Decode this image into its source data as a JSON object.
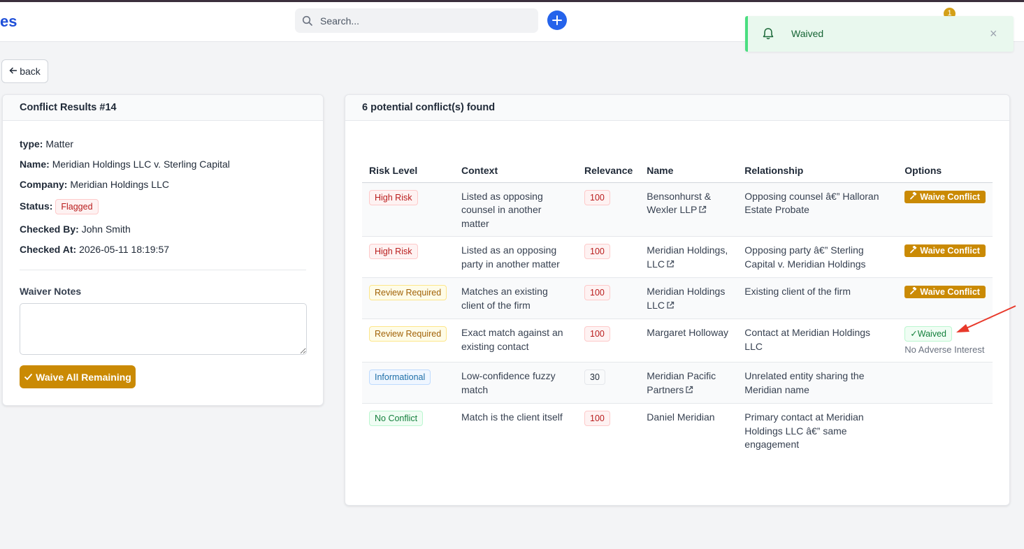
{
  "header": {
    "brand": "es",
    "search_placeholder": "Search...",
    "notification_count": "1"
  },
  "toast": {
    "message": "Waived",
    "close": "×"
  },
  "back_label": "back",
  "details": {
    "title": "Conflict Results #14",
    "type_label": "type:",
    "type_value": "Matter",
    "name_label": "Name:",
    "name_value": "Meridian Holdings LLC v. Sterling Capital",
    "company_label": "Company:",
    "company_value": "Meridian Holdings LLC",
    "status_label": "Status:",
    "status_value": "Flagged",
    "checked_by_label": "Checked By:",
    "checked_by_value": "John Smith",
    "checked_at_label": "Checked At:",
    "checked_at_value": "2026-05-11 18:19:57",
    "waiver_notes_label": "Waiver Notes",
    "waive_all_label": "Waive All Remaining"
  },
  "results": {
    "title": "6 potential conflict(s) found",
    "columns": [
      "Risk Level",
      "Context",
      "Relevance",
      "Name",
      "Relationship",
      "Options"
    ],
    "waive_label": "Waive Conflict",
    "waived_label": "Waived",
    "rows": [
      {
        "risk": "High Risk",
        "context": "Listed as opposing counsel in another matter",
        "relevance": "100",
        "name": "Bensonhurst & Wexler LLP",
        "relationship": "Opposing counsel â€” Halloran Estate Probate"
      },
      {
        "risk": "High Risk",
        "context": "Listed as an opposing party in another matter",
        "relevance": "100",
        "name": "Meridian Holdings, LLC",
        "relationship": "Opposing party â€” Sterling Capital v. Meridian Holdings"
      },
      {
        "risk": "Review Required",
        "context": "Matches an existing client of the firm",
        "relevance": "100",
        "name": "Meridian Holdings LLC",
        "relationship": "Existing client of the firm"
      },
      {
        "risk": "Review Required",
        "context": "Exact match against an existing contact",
        "relevance": "100",
        "name": "Margaret Holloway",
        "relationship": "Contact at Meridian Holdings LLC",
        "waived_note": "No Adverse Interest"
      },
      {
        "risk": "Informational",
        "context": "Low-confidence fuzzy match",
        "relevance": "30",
        "name": "Meridian Pacific Partners",
        "relationship": "Unrelated entity sharing the Meridian name"
      },
      {
        "risk": "No Conflict",
        "context": "Match is the client itself",
        "relevance": "100",
        "name": "Daniel Meridian",
        "relationship": "Primary contact at Meridian Holdings LLC â€” same engagement"
      }
    ]
  },
  "colors": {
    "accent": "#2563eb",
    "waive": "#ca8a04",
    "toast_bg": "#e9f8ee",
    "arrow": "#e8392b"
  }
}
